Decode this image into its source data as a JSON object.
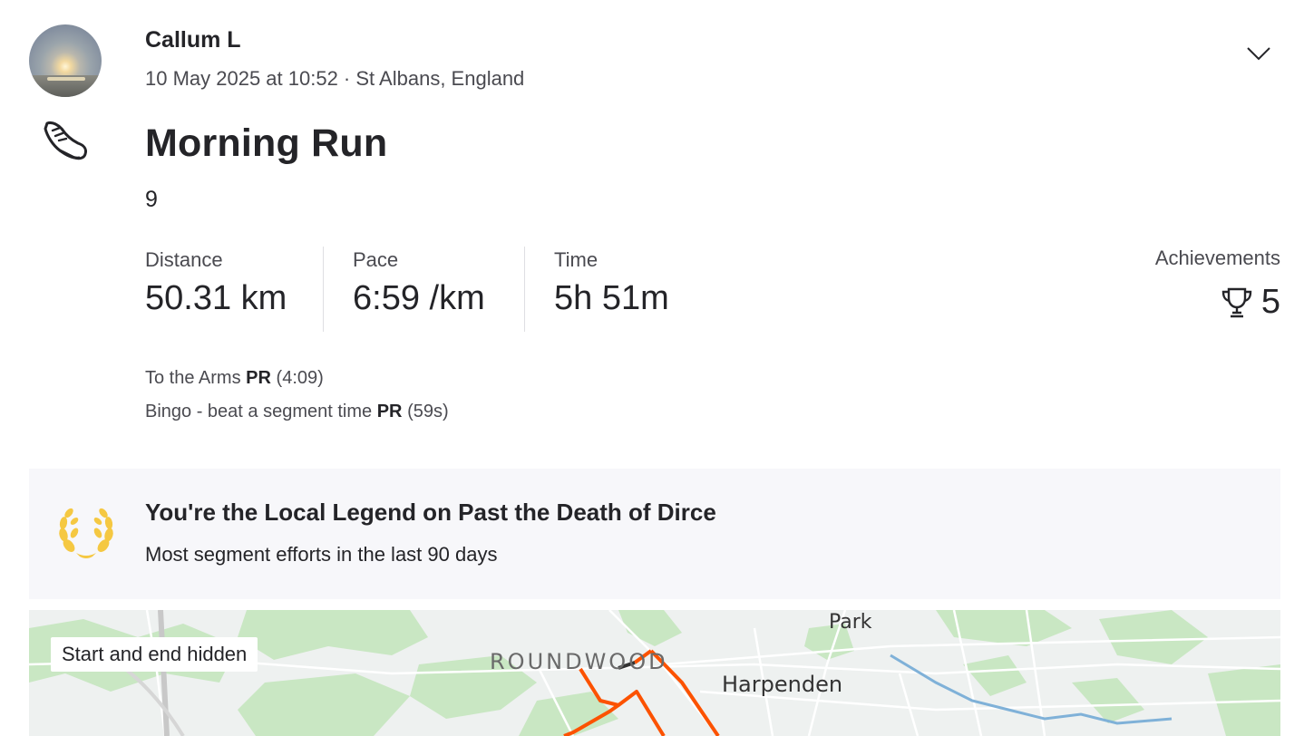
{
  "athlete": {
    "name": "Callum L",
    "meta": "10 May 2025 at 10:52 · St Albans, England"
  },
  "activity": {
    "type_icon": "running-shoe-icon",
    "title": "Morning Run",
    "description": "9"
  },
  "stats": [
    {
      "label": "Distance",
      "value": "50.31 km"
    },
    {
      "label": "Pace",
      "value": "6:59 /km"
    },
    {
      "label": "Time",
      "value": "5h 51m"
    }
  ],
  "achievements": {
    "label": "Achievements",
    "count": "5",
    "icon": "trophy-icon"
  },
  "segment_prs": [
    {
      "name": "To the Arms",
      "badge": "PR",
      "time": "(4:09)"
    },
    {
      "name": "Bingo - beat a segment time",
      "badge": "PR",
      "time": "(59s)"
    }
  ],
  "local_legend": {
    "icon": "laurel-icon",
    "title": "You're the Local Legend on Past the Death of Dirce",
    "subtitle": "Most segment efforts in the last 90 days"
  },
  "map": {
    "badge": "Start and end hidden",
    "labels": {
      "park": "Park",
      "roundwood": "ROUNDWOOD",
      "harpenden": "Harpenden"
    },
    "route_color": "#fc5200",
    "water_color": "#7fb1d8",
    "green_color": "#c9e7c3"
  },
  "colors": {
    "text": "#242428",
    "secondary": "#4a4a50",
    "legend_bg": "#f7f7fa",
    "laurel": "#f5c842"
  }
}
